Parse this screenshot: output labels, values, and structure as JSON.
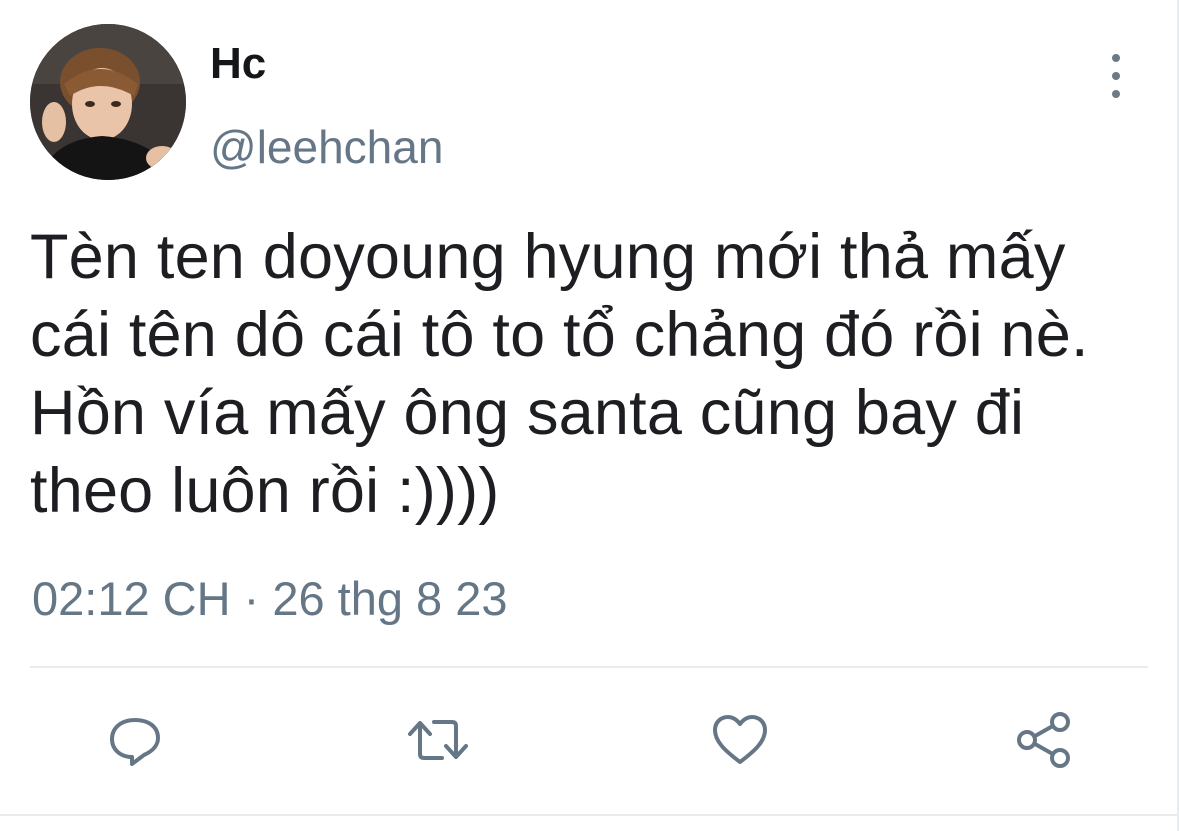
{
  "tweet": {
    "display_name": "Hc",
    "handle": "@leehchan",
    "text_lines": [
      "Tèn ten doyoung hyung mới thả mấy",
      "cái tên dô cái tô to tổ chảng đó rồi nè.",
      "Hồn vía mấy ông santa cũng bay đi",
      "theo luôn rồi :))))"
    ],
    "timestamp": "02:12 CH · 26 thg 8 23"
  },
  "icons": {
    "menu": "more-vertical-icon",
    "reply": "reply-icon",
    "retweet": "retweet-icon",
    "like": "heart-icon",
    "share": "share-icon"
  },
  "colors": {
    "text": "#1c1e21",
    "secondary": "#657786",
    "icon": "#657786",
    "divider": "#e6ecf0"
  }
}
